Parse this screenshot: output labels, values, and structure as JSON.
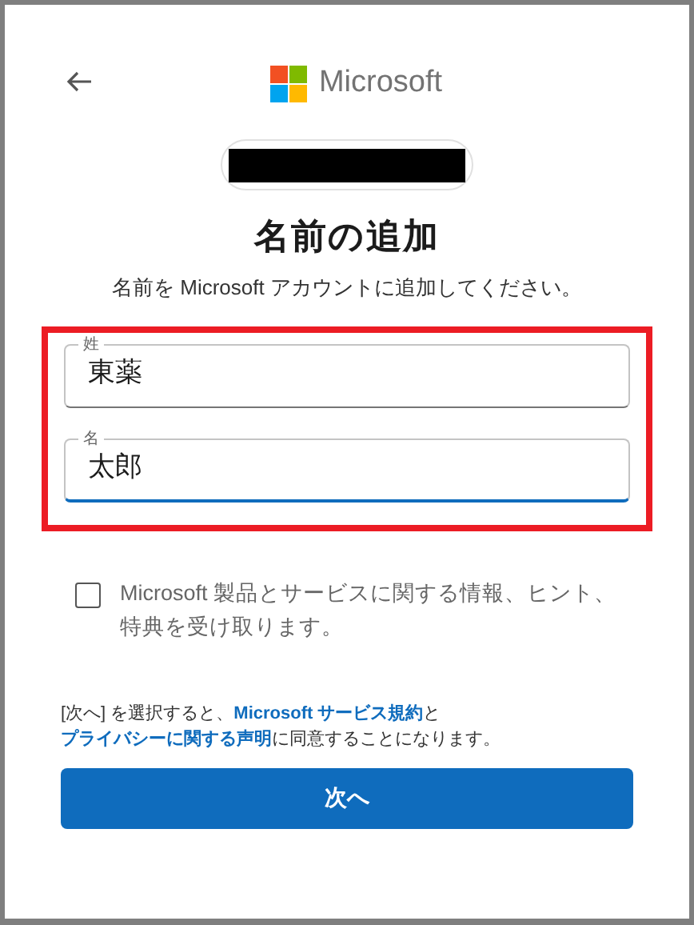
{
  "header": {
    "brand": "Microsoft"
  },
  "title": "名前の追加",
  "subtitle": "名前を Microsoft アカウントに追加してください。",
  "fields": [
    {
      "label": "姓",
      "value": "東薬",
      "focused": false
    },
    {
      "label": "名",
      "value": "太郎",
      "focused": true
    }
  ],
  "marketing_checkbox": {
    "label": "Microsoft 製品とサービスに関する情報、ヒント、特典を受け取ります。",
    "checked": false
  },
  "consent": [
    {
      "kind": "text",
      "text": "[次へ] を選択すると、"
    },
    {
      "kind": "link",
      "text": "Microsoft サービス規約"
    },
    {
      "kind": "text",
      "text": "と"
    },
    {
      "kind": "link",
      "text": "プライバシーに関する声明"
    },
    {
      "kind": "text",
      "text": "に同意することになります。"
    }
  ],
  "next_button": "次へ"
}
